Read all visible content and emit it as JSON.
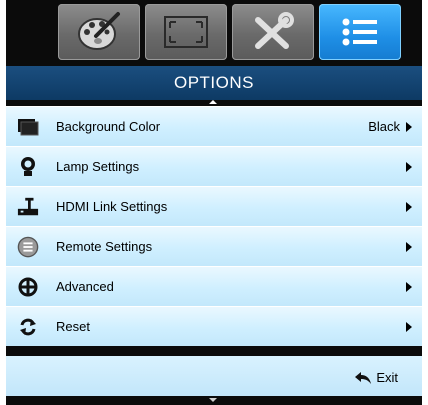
{
  "tabs": [
    {
      "name": "image-tab",
      "icon": "palette-icon",
      "active": false
    },
    {
      "name": "display-tab",
      "icon": "screen-resize-icon",
      "active": false
    },
    {
      "name": "setup-tab",
      "icon": "tools-icon",
      "active": false
    },
    {
      "name": "options-tab",
      "icon": "list-menu-icon",
      "active": true
    }
  ],
  "header": {
    "title": "OPTIONS"
  },
  "menu": {
    "items": [
      {
        "label": "Background Color",
        "value": "Black",
        "icon": "background-color-icon"
      },
      {
        "label": "Lamp Settings",
        "value": "",
        "icon": "lamp-icon"
      },
      {
        "label": "HDMI Link Settings",
        "value": "",
        "icon": "hdmi-link-icon"
      },
      {
        "label": "Remote Settings",
        "value": "",
        "icon": "remote-icon"
      },
      {
        "label": "Advanced",
        "value": "",
        "icon": "advanced-icon"
      },
      {
        "label": "Reset",
        "value": "",
        "icon": "reset-icon"
      }
    ]
  },
  "footer": {
    "exit_label": "Exit"
  },
  "colors": {
    "accent": "#1f8fe6",
    "header_bg": "#123f6c",
    "row_bg": "#cfefff"
  }
}
